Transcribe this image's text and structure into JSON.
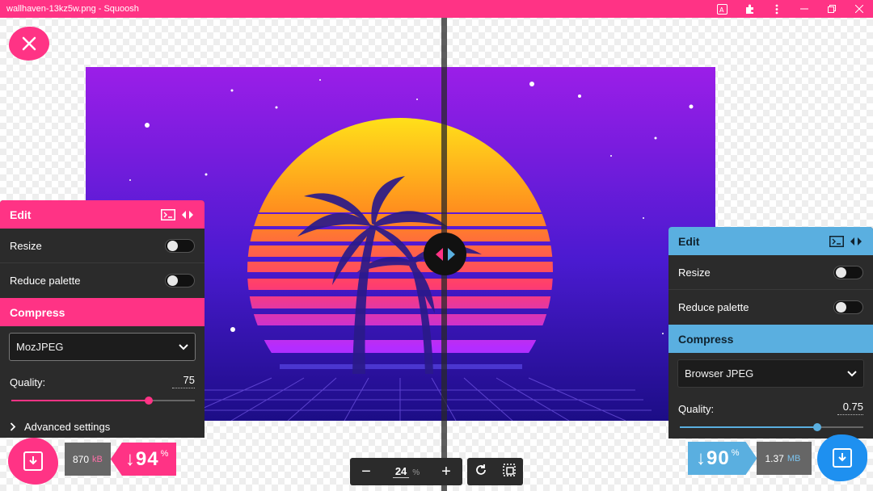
{
  "window": {
    "title": "wallhaven-13kz5w.png - Squoosh",
    "accent": "#ff3385"
  },
  "icons": {
    "close": "close-icon",
    "translate": "translate-icon",
    "extensions": "puzzle-icon",
    "menu": "more-vert-icon",
    "restore": "restore-icon",
    "window_close": "window-close-icon"
  },
  "left_panel": {
    "edit_label": "Edit",
    "resize_label": "Resize",
    "reduce_palette_label": "Reduce palette",
    "compress_label": "Compress",
    "encoder": "MozJPEG",
    "quality_label": "Quality:",
    "quality_value": "75",
    "quality_fraction": 0.75,
    "advanced_label": "Advanced settings",
    "accent": "#ff3385",
    "size_value": "870",
    "size_unit": "kB",
    "percent_arrow": "↓",
    "percent_value": "94",
    "percent_sign": "%"
  },
  "right_panel": {
    "edit_label": "Edit",
    "resize_label": "Resize",
    "reduce_palette_label": "Reduce palette",
    "compress_label": "Compress",
    "encoder": "Browser JPEG",
    "quality_label": "Quality:",
    "quality_value": "0.75",
    "quality_fraction": 0.75,
    "accent": "#5aafe0",
    "size_value": "1.37",
    "size_unit": "MB",
    "percent_arrow": "↓",
    "percent_value": "90",
    "percent_sign": "%"
  },
  "zoom": {
    "value": "24",
    "unit": "%",
    "minus": "−",
    "plus": "+"
  }
}
